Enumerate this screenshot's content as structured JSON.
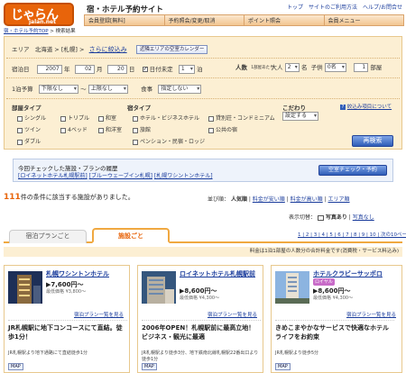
{
  "header": {
    "logo_text": "じゃらん",
    "logo_sub": "jalan.net",
    "title": "宿・ホテル予約サイト",
    "recruit": "PRODUCED BY RECRUIT",
    "toplinks": [
      "トップ",
      "サイトのご利用方法",
      "ヘルプ/お問合せ"
    ],
    "nav": [
      "会員登録[無料]",
      "予約照会/変更/取消",
      "ポイント照会",
      "会員メニュー"
    ],
    "breadcrumb": [
      "宿・ホテル予約TOP",
      "検索結果"
    ]
  },
  "search": {
    "area_label": "エリア",
    "area_value": "北海道 > [札幌] >",
    "area_more": "さらに絞込み",
    "area_calendar_btn": "近隣エリアの空室カレンダー",
    "date_label": "宿泊日",
    "year": "2007",
    "year_unit": "年",
    "month": "02",
    "month_unit": "月",
    "day": "20",
    "day_unit": "日",
    "undecided_label": "日付未定",
    "nights": "1",
    "nights_unit": "泊",
    "people_label": "人数",
    "people_sub": "1部屋あたり",
    "adult_label": "大人",
    "adult_value": "2",
    "adult_unit": "名",
    "child_label": "子供",
    "child_value": "0名",
    "rooms": "1",
    "rooms_unit": "部屋",
    "budget_label": "1泊予算",
    "budget_min": "下限なし",
    "budget_sep": "～",
    "budget_max": "上限なし",
    "meal_label": "食事",
    "meal_value": "指定しない",
    "room_type_title": "部屋タイプ",
    "room_types": [
      "シングル",
      "トリプル",
      "和室",
      "ツイン",
      "4ベッド",
      "和洋室",
      "ダブル"
    ],
    "inn_type_title": "宿タイプ",
    "inn_types": [
      "ホテル・ビジネスホテル",
      "貸別荘・コンドミニアム",
      "旅館",
      "公共の宿",
      "ペンション・民宿・ロッジ"
    ],
    "kodawari_title": "こだわり",
    "kodawari_value": "設定する",
    "kodawari_more": "絞込み項目について",
    "search_btn": "再検索"
  },
  "history": {
    "title": "今回チェックした施設・プランの履歴",
    "items": [
      "[ロイネットホテル札幌駅前]",
      "[ブルーウェーブイン札幌]",
      "[札幌ワシントンホテル]"
    ],
    "button": "空室チェック・予約"
  },
  "results": {
    "count": "111",
    "count_text": "件の条件に該当する施設がありました。",
    "sort_label": "並び順：",
    "sort_active": "人気順",
    "sort_options": [
      "料金が安い順",
      "料金が高い順",
      "エリア順"
    ],
    "display_label": "表示切替：",
    "display_photo": "写真あり",
    "display_nophoto": "写真なし",
    "tab_plan": "宿泊プランごと",
    "tab_shisetsu": "施設ごと",
    "pager": "1 | 2 | 3 | 4 | 5 | 6 | 7 | 8 | 9 | 10 | 次の10ページ→",
    "note": "料金は1泊1部屋の人数分の合計料金です(消費税・サービス料込み)"
  },
  "hotels": [
    {
      "name": "札幌ワシントンホテル",
      "price": "7,600円～",
      "avg": "最低価格 ¥3,800～",
      "plan_link": "宿泊プラン一覧を見る",
      "pr": "JR札幌駅に地下コンコースにて直結。徒歩1分！",
      "addr": "JR札幌駅より地下通路にて直結徒歩1分",
      "map": "MAP"
    },
    {
      "name": "ロイネットホテル札幌駅前",
      "price": "8,600円～",
      "avg": "最低価格 ¥4,300～",
      "plan_link": "宿泊プラン一覧を見る",
      "pr": "2006年OPEN！札幌駅前に最高立地！ビジネス・観光に最適",
      "addr": "JR札幌駅より徒歩3分、地下鉄南北線札幌駅22番出口より徒歩1分",
      "map": "MAP"
    },
    {
      "name": "ホテルクラビーサッポロ",
      "badge": "ロイヤル",
      "price": "8,600円～",
      "avg": "最低価格 ¥4,300～",
      "plan_link": "宿泊プラン一覧を見る",
      "pr": "きめこまやかなサービスで快適なホテルライフをお約束",
      "addr": "JR札幌駅より徒歩5分",
      "map": "MAP"
    }
  ]
}
